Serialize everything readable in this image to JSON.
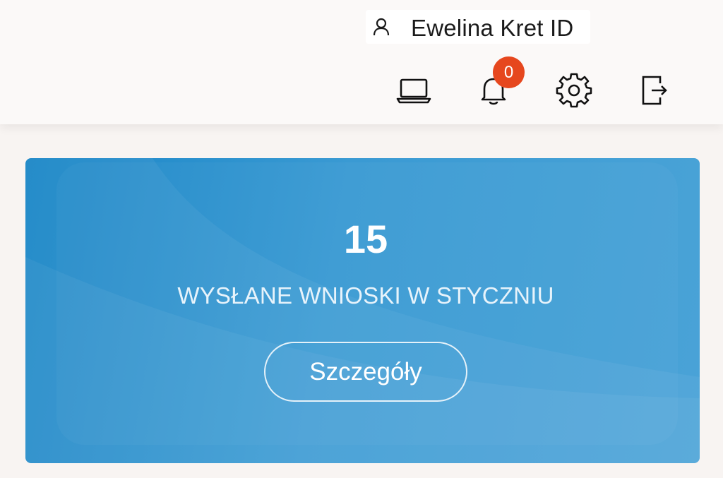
{
  "header": {
    "user_name": "Ewelina Kret ID",
    "notifications_count": "0",
    "icons": [
      "user-icon",
      "laptop-icon",
      "bell-icon",
      "gear-icon",
      "logout-icon"
    ]
  },
  "summary_card": {
    "count": "15",
    "caption": "WYSŁANE WNIOSKI W STYCZNIU",
    "details_button": "Szczegóły"
  },
  "colors": {
    "card_gradient_start": "#1a86c7",
    "card_gradient_end": "#4aa3d7",
    "badge": "#e6471e",
    "header_bg": "#fbf9f8"
  }
}
